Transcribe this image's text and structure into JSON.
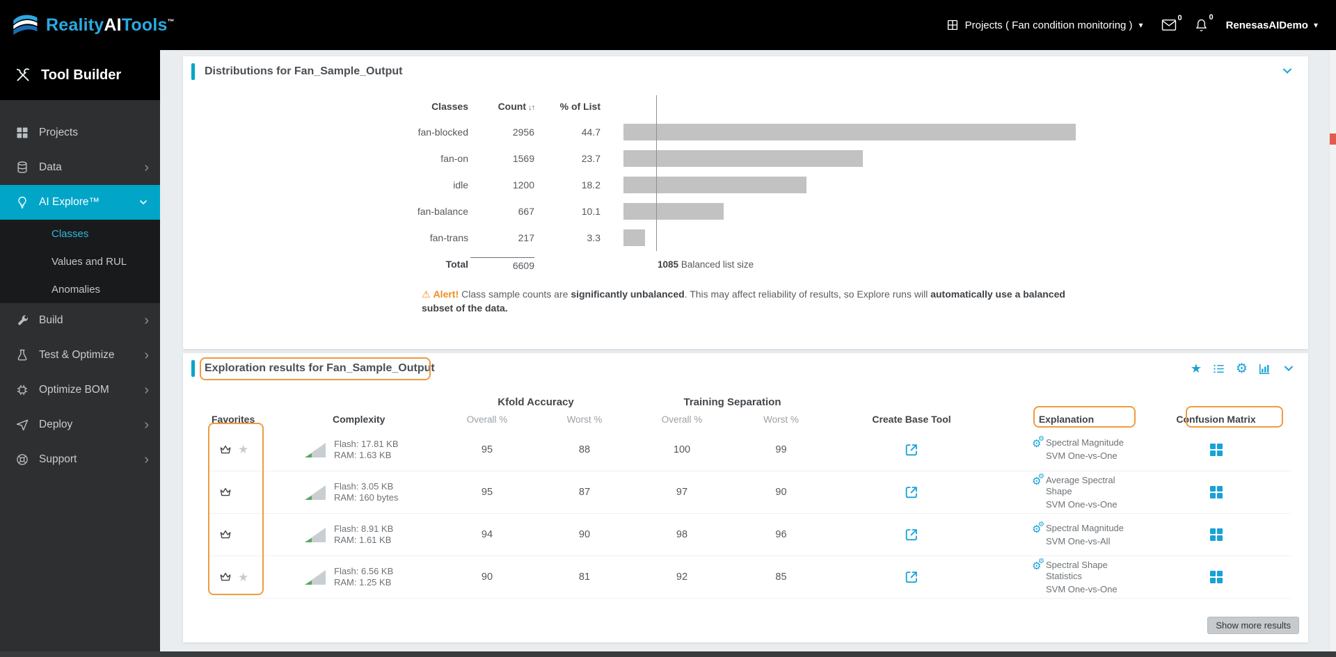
{
  "topbar": {
    "brand": {
      "part1": "Reality",
      "part2": "AI",
      "part3": "Tools",
      "tm": "™"
    },
    "projects_menu": "Projects ( Fan condition monitoring )",
    "mail_badge": "0",
    "notif_badge": "0",
    "username": "RenesasAIDemo"
  },
  "sidebar": {
    "header": "Tool Builder",
    "items": {
      "projects": "Projects",
      "data": "Data",
      "ai_explore": "AI Explore™",
      "build": "Build",
      "test_optimize": "Test & Optimize",
      "optimize_bom": "Optimize BOM",
      "deploy": "Deploy",
      "support": "Support"
    },
    "ai_explore_sub": {
      "classes": "Classes",
      "values_rul": "Values and RUL",
      "anomalies": "Anomalies"
    }
  },
  "distributions": {
    "title": "Distributions for Fan_Sample_Output",
    "col_classes": "Classes",
    "col_count": "Count",
    "col_pct": "% of List",
    "rows": [
      {
        "cls": "fan-blocked",
        "count": "2956",
        "pct": "44.7",
        "bar": "650px"
      },
      {
        "cls": "fan-on",
        "count": "1569",
        "pct": "23.7",
        "bar": "344px"
      },
      {
        "cls": "idle",
        "count": "1200",
        "pct": "18.2",
        "bar": "263px"
      },
      {
        "cls": "fan-balance",
        "count": "667",
        "pct": "10.1",
        "bar": "144px"
      },
      {
        "cls": "fan-trans",
        "count": "217",
        "pct": "3.3",
        "bar": "31px"
      }
    ],
    "total_label": "Total",
    "total_count": "6609",
    "balanced_value": "1085",
    "balanced_label": "Balanced list size",
    "alert": {
      "icon_label": "Alert!",
      "t1": "Class sample counts are ",
      "b1": "significantly unbalanced",
      "t2": ". This may affect reliability of results, so Explore runs will ",
      "b2": "automatically use a balanced subset of the data."
    }
  },
  "exploration": {
    "title": "Exploration results for Fan_Sample_Output",
    "headers": {
      "favorites": "Favorites",
      "complexity": "Complexity",
      "kfold": "Kfold Accuracy",
      "training": "Training Separation",
      "overall": "Overall %",
      "worst": "Worst %",
      "create": "Create Base Tool",
      "explanation": "Explanation",
      "confusion": "Confusion Matrix"
    },
    "rows": [
      {
        "flash": "Flash: 17.81 KB",
        "ram": "RAM: 1.63 KB",
        "k_overall": "95",
        "k_worst": "88",
        "t_overall": "100",
        "t_worst": "99",
        "method": "Spectral Magnitude",
        "model": "SVM One-vs-One"
      },
      {
        "flash": "Flash: 3.05 KB",
        "ram": "RAM: 160 bytes",
        "k_overall": "95",
        "k_worst": "87",
        "t_overall": "97",
        "t_worst": "90",
        "method": "Average Spectral Shape",
        "model": "SVM One-vs-One"
      },
      {
        "flash": "Flash: 8.91 KB",
        "ram": "RAM: 1.61 KB",
        "k_overall": "94",
        "k_worst": "90",
        "t_overall": "98",
        "t_worst": "96",
        "method": "Spectral Magnitude",
        "model": "SVM One-vs-All"
      },
      {
        "flash": "Flash: 6.56 KB",
        "ram": "RAM: 1.25 KB",
        "k_overall": "90",
        "k_worst": "81",
        "t_overall": "92",
        "t_worst": "85",
        "method": "Spectral Shape Statistics",
        "model": "SVM One-vs-One"
      }
    ],
    "show_more": "Show more results"
  },
  "chart_data": {
    "type": "bar",
    "orientation": "horizontal",
    "title": "Distributions for Fan_Sample_Output",
    "categories": [
      "fan-blocked",
      "fan-on",
      "idle",
      "fan-balance",
      "fan-trans"
    ],
    "values": [
      2956,
      1569,
      1200,
      667,
      217
    ],
    "percent_of_list": [
      44.7,
      23.7,
      18.2,
      10.1,
      3.3
    ],
    "total": 6609,
    "balanced_list_size": 1085
  },
  "colors": {
    "accent_cyan": "#00a5c8",
    "icon_blue": "#17a2d8",
    "annotation_orange": "#f09b3d",
    "alert_orange": "#f08c1e",
    "bar_gray": "#c2c2c2"
  }
}
